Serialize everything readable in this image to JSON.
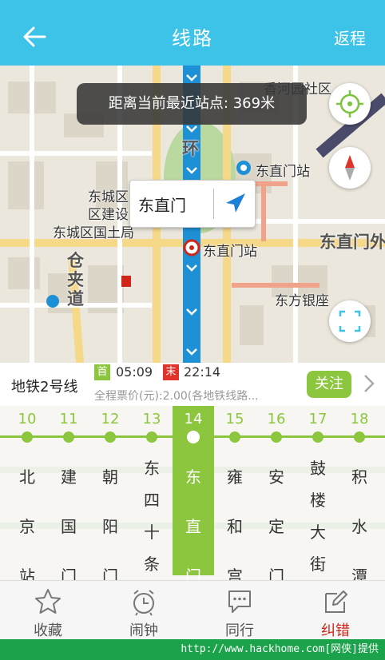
{
  "header": {
    "title": "线路",
    "return_label": "返程"
  },
  "map": {
    "toast": "距离当前最近站点: 369米",
    "callout_station": "东直门",
    "labels": {
      "l1": "东城区",
      "l2": "区建设",
      "l3": "东城区国土局",
      "l4": "东直门站",
      "l5": "东直门站",
      "l6": "东直门外",
      "l7": "东方银座",
      "l8": "仓夹道",
      "l9": "环",
      "l10": "香河园社区"
    }
  },
  "line": {
    "name": "地铁2号线",
    "first_badge": "首",
    "first_time": "05:09",
    "last_badge": "末",
    "last_time": "22:14",
    "fare": "全程票价(元):2.00(各地铁线路...",
    "follow_label": "关注"
  },
  "stations": [
    {
      "num": "10",
      "name": "北京站"
    },
    {
      "num": "11",
      "name": "建国门"
    },
    {
      "num": "12",
      "name": "朝阳门"
    },
    {
      "num": "13",
      "name": "东四十条"
    },
    {
      "num": "14",
      "name": "东直门"
    },
    {
      "num": "15",
      "name": "雍和宫"
    },
    {
      "num": "16",
      "name": "安定门"
    },
    {
      "num": "17",
      "name": "鼓楼大街"
    },
    {
      "num": "18",
      "name": "积水潭"
    }
  ],
  "selected_station": "14",
  "tabs": [
    {
      "label": "收藏",
      "icon": "star-icon"
    },
    {
      "label": "闹钟",
      "icon": "alarm-clock-icon"
    },
    {
      "label": "同行",
      "icon": "chat-bubble-icon"
    },
    {
      "label": "纠错",
      "icon": "edit-icon"
    }
  ],
  "footer": "http://www.hackhome.com[网侠]提供",
  "colors": {
    "header": "#3ec3e8",
    "accent": "#8cc63e",
    "active_tab": "#d0261a",
    "metro_line": "#1e90d6"
  }
}
